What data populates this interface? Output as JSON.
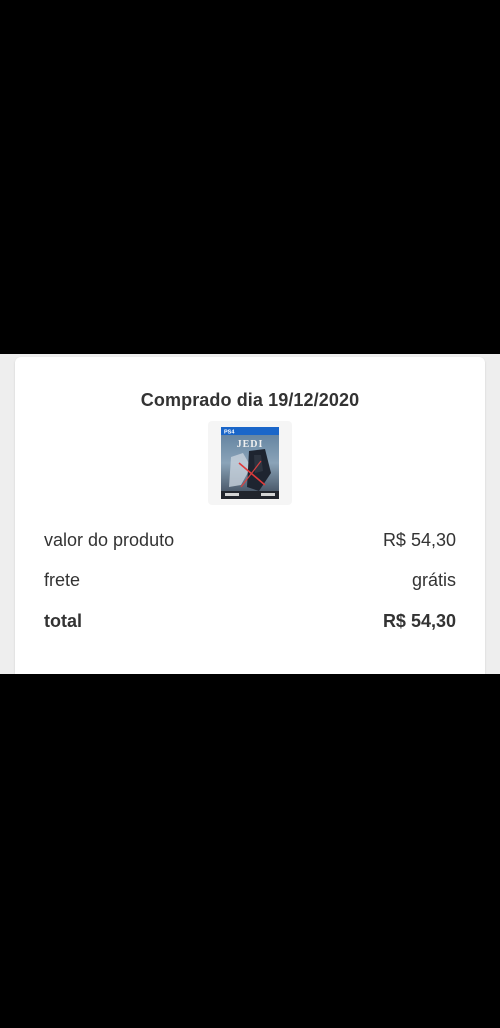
{
  "order": {
    "title": "Comprado dia 19/12/2020",
    "product_image": {
      "icon": "game-box-art-icon",
      "platform_badge": "PS4",
      "cover_text": "JEDI"
    },
    "summary": [
      {
        "label": "valor do produto",
        "value": "R$ 54,30",
        "bold": false
      },
      {
        "label": "frete",
        "value": "grátis",
        "bold": false
      },
      {
        "label": "total",
        "value": "R$ 54,30",
        "bold": true
      }
    ]
  },
  "colors": {
    "background": "#000000",
    "card": "#ffffff",
    "text": "#333333",
    "ps4_blue": "#1a66c9"
  }
}
